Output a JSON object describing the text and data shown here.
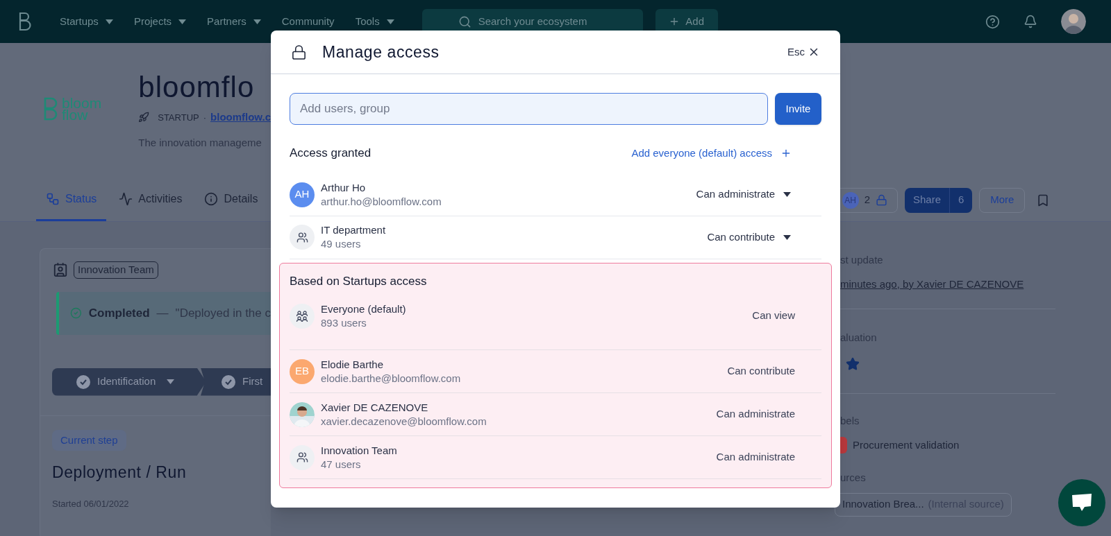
{
  "nav": {
    "items": [
      {
        "label": "Startups",
        "dropdown": true
      },
      {
        "label": "Projects",
        "dropdown": true
      },
      {
        "label": "Partners",
        "dropdown": true
      },
      {
        "label": "Community",
        "dropdown": false
      },
      {
        "label": "Tools",
        "dropdown": true
      }
    ],
    "search": {
      "placeholder": "Search your ecosystem"
    },
    "add_button": "Add"
  },
  "header": {
    "logo": [
      "bloom",
      "flow"
    ],
    "title": "bloomflo",
    "type": "STARTUP",
    "separator": "·",
    "website": "bloomflow.c",
    "description": "The innovation manageme"
  },
  "tabs": [
    {
      "label": "Status",
      "selected": true
    },
    {
      "label": "Activities",
      "selected": false
    },
    {
      "label": "Details",
      "selected": false
    }
  ],
  "actions": {
    "access": {
      "initials": "AH",
      "count": "2"
    },
    "share": {
      "label": "Share",
      "count": "6"
    },
    "more": "More"
  },
  "card": {
    "team": "Innovation Team",
    "banner": {
      "status": "Completed",
      "dash": "—",
      "quote": "\"Deployed in the c"
    },
    "steps": [
      {
        "label": "Identification",
        "dropdown": true
      },
      {
        "label": "First",
        "dropdown": false
      }
    ],
    "current_badge": "Current step",
    "step_title": "Deployment / Run",
    "started": "Started 06/01/2022"
  },
  "sidebar": {
    "last_update_label": "st update",
    "last_update": "minutes ago, by Xavier DE CAZENOVE",
    "evaluation_label": "aluation",
    "labels_label": "bels",
    "label": {
      "text": "Procurement validation",
      "color": "#b7383c"
    },
    "sources_label": "urces",
    "source": {
      "name": "Innovation Brea...",
      "kind": "(Internal source)"
    }
  },
  "modal": {
    "title": "Manage access",
    "esc": "Esc",
    "input": {
      "placeholder": "Add users, group"
    },
    "invite": "Invite",
    "granted": {
      "title": "Access granted",
      "add_link": "Add everyone (default) access",
      "members": [
        {
          "name": "Arthur Ho",
          "detail": "arthur.ho@bloomflow.com",
          "permission": "Can administrate",
          "kind": "initials",
          "initials": "AH",
          "color": "#5b8def",
          "dropdown": true
        },
        {
          "name": "IT department",
          "detail": "49 users",
          "permission": "Can contribute",
          "kind": "group",
          "dropdown": true
        }
      ]
    },
    "inherited": {
      "title": "Based on Startups access",
      "members": [
        {
          "name": "Everyone (default)",
          "detail": "893 users",
          "permission": "Can view",
          "kind": "everyone",
          "dropdown": false
        },
        {
          "name": "Elodie Barthe",
          "detail": "elodie.barthe@bloomflow.com",
          "permission": "Can contribute",
          "kind": "initials",
          "initials": "EB",
          "color": "#fba86f",
          "dropdown": false
        },
        {
          "name": "Xavier DE CAZENOVE",
          "detail": "xavier.decazenove@bloomflow.com",
          "permission": "Can administrate",
          "dropdown": false
        },
        {
          "name": "Innovation Team",
          "detail": "47 users",
          "permission": "Can administrate",
          "kind": "group",
          "dropdown": false
        }
      ]
    }
  }
}
